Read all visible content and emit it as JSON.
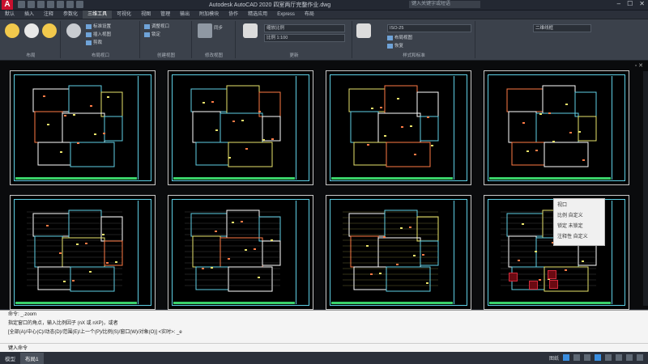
{
  "app": {
    "logo": "A",
    "title": "Autodesk AutoCAD 2020    四室两厅完整作业.dwg",
    "search_placeholder": "键入关键字或短语"
  },
  "window_buttons": [
    "–",
    "☐",
    "✕"
  ],
  "menu": [
    "默认",
    "插入",
    "注释",
    "参数化",
    "三维工具",
    "可视化",
    "视图",
    "管理",
    "输出",
    "附加模块",
    "协作",
    "精选应用",
    "Express",
    "布局"
  ],
  "menu_active_index": 14,
  "ribbon": {
    "groups": [
      {
        "label": "布局"
      },
      {
        "label": "布局视口"
      },
      {
        "label": "创建视图"
      },
      {
        "label": "修改视图"
      },
      {
        "label": "更新"
      },
      {
        "label": "样式和标准"
      }
    ],
    "small_items": [
      "标准设置",
      "插入视图",
      "剪裁",
      "调整视口",
      "锁定",
      "同步",
      "布局视图",
      "恢复"
    ],
    "dropdown_1": "缩放比例",
    "dropdown_2": "比例 1:100",
    "dropdown_3": "ISO-25",
    "dropdown_4": "二维线框"
  },
  "tooltip": {
    "lines": [
      "视口",
      "比例  自定义",
      "锁定  未锁定",
      "注释性  自定义"
    ]
  },
  "command": {
    "history": [
      "命令: _.zoom",
      "指定窗口的角点，输入比例因子 (nX 或 nXP)，或者",
      "[全部(A)/中心(C)/动态(D)/范围(E)/上一个(P)/比例(S)/窗口(W)/对象(O)] <实时>: _e"
    ],
    "prompt": "键入命令"
  },
  "layout_tabs": [
    "模型",
    "布局1"
  ],
  "layout_active": 1,
  "status": {
    "paper_label": "图纸"
  },
  "colors": {
    "accent": "#3a8ee0",
    "frame": "#5fd0e6",
    "strip": "#3ad26a",
    "red": "#d12a3a"
  }
}
